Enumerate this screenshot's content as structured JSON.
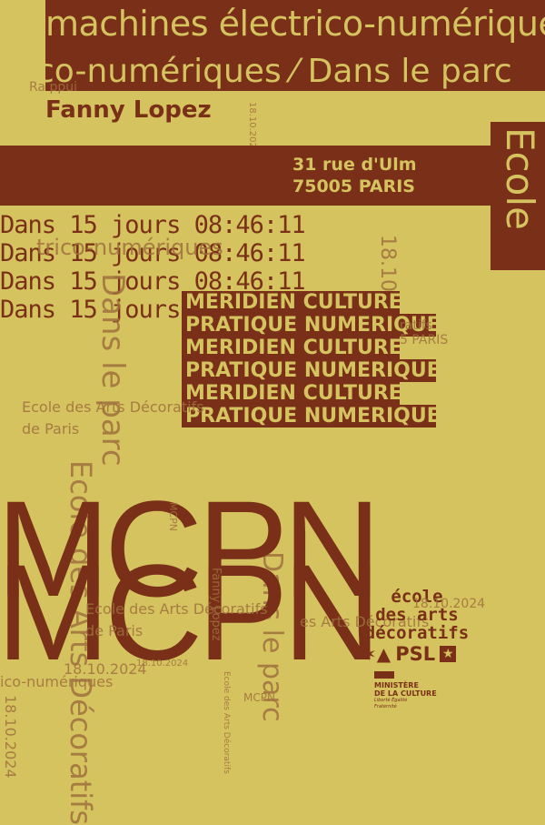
{
  "banner_top": "machines électrico-numériques",
  "banner_second": "co-numériques ⁄ Dans le parc",
  "author": "Fanny Lopez",
  "address": {
    "line1": "31 rue d'Ulm",
    "line2": "75005 PARIS"
  },
  "side_word": "Ecole",
  "countdown": [
    "Dans 15 jours 08:46:11",
    "Dans 15 jours 08:46:11",
    "Dans 15 jours 08:46:11",
    "Dans 15 jours"
  ],
  "boxes": [
    "MERIDIEN CULTURE",
    "PRATIQUE NUMERIQUE",
    "MERIDIEN CULTURE",
    "PRATIQUE NUMERIQUE",
    "MERIDIEN CULTURE",
    "PRATIQUE NUMERIQUE"
  ],
  "school_name_1": "Ecole des Arts Décoratifs",
  "school_name_2": "de Paris",
  "acronym": "MCPN",
  "date": "18.10.2024",
  "bottom_left_text": "ico-numériques",
  "vertical_park": "Dans le parc",
  "logos": {
    "eda_line1": "école",
    "eda_line2": "des arts",
    "eda_line3": "décoratifs",
    "psl": "PSL",
    "ministere_line1": "MINISTÈRE",
    "ministere_line2": "DE LA CULTURE",
    "ministere_motto": "Liberté Égalité Fraternité"
  },
  "colors": {
    "background": "#d4c35e",
    "brown": "#7a3018"
  }
}
